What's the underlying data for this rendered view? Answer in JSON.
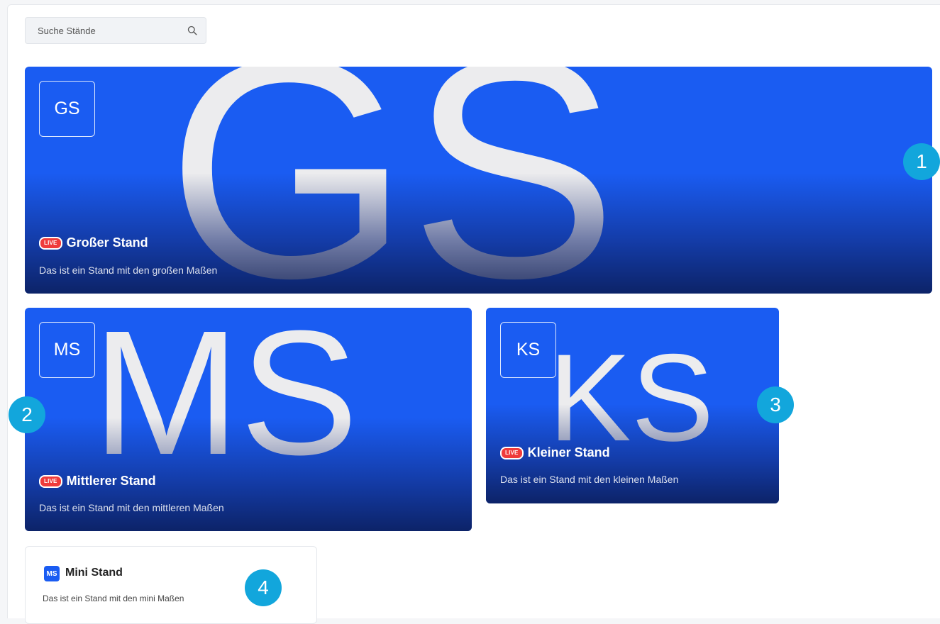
{
  "search": {
    "placeholder": "Suche Stände"
  },
  "stands": [
    {
      "abbr": "GS",
      "badge": "LIVE",
      "title": "Großer Stand",
      "description": "Das ist ein Stand mit den großen Maßen"
    },
    {
      "abbr": "MS",
      "badge": "LIVE",
      "title": "Mittlerer Stand",
      "description": "Das ist ein Stand mit den mittleren Maßen"
    },
    {
      "abbr": "KS",
      "badge": "LIVE",
      "title": "Kleiner Stand",
      "description": "Das ist ein Stand mit den kleinen Maßen"
    }
  ],
  "mini_stand": {
    "abbr": "MS",
    "title": "Mini Stand",
    "description": "Das ist ein Stand mit den mini Maßen"
  },
  "markers": [
    "1",
    "2",
    "3",
    "4"
  ],
  "colors": {
    "card_blue": "#1a5cf2",
    "live_red": "#ef3b3b",
    "marker_cyan": "#12a6dc"
  },
  "icons": {
    "search": "search-icon"
  }
}
